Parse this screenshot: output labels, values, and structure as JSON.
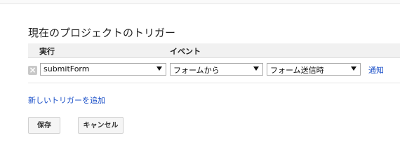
{
  "dialog": {
    "title": "現在のプロジェクトのトリガー"
  },
  "table": {
    "headers": {
      "run": "実行",
      "event": "イベント"
    },
    "rows": [
      {
        "delete_icon": "close-icon",
        "function": "submitForm",
        "source": "フォームから",
        "event": "フォーム送信時",
        "notify_link": "通知"
      }
    ]
  },
  "actions": {
    "add_trigger": "新しいトリガーを追加",
    "save": "保存",
    "cancel": "キャンセル"
  }
}
